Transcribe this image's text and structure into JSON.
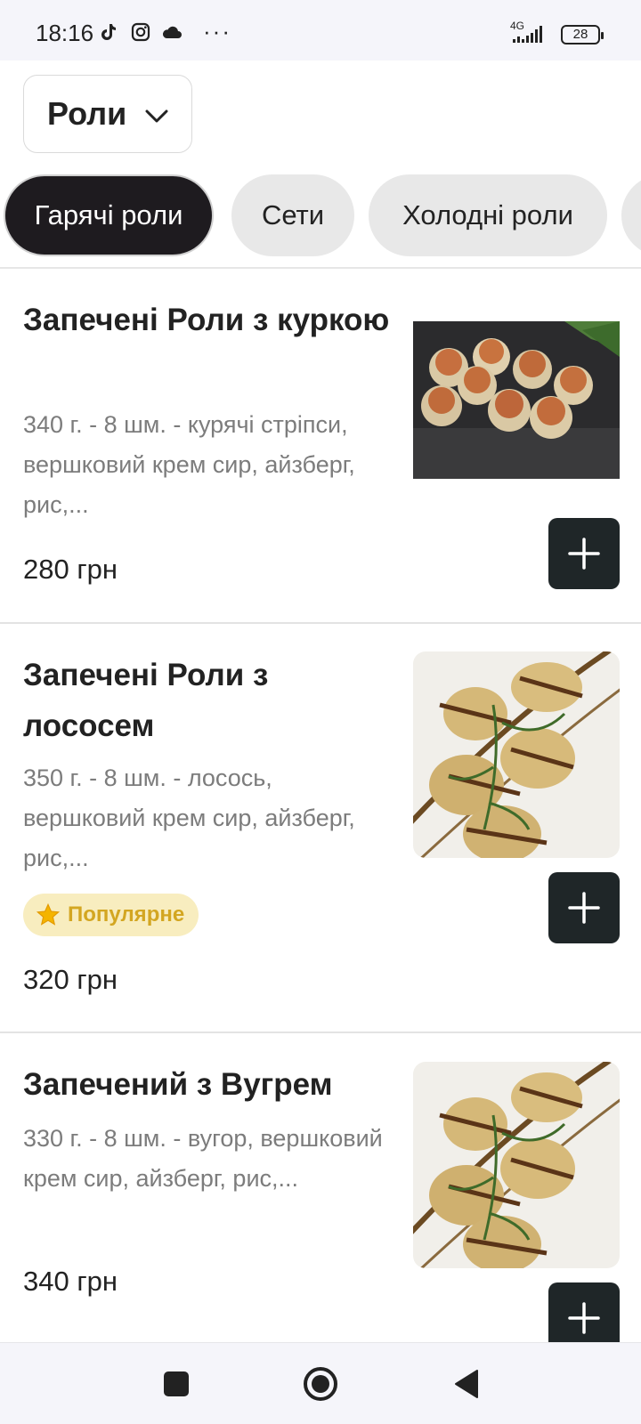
{
  "status_bar": {
    "time": "18:16",
    "network": "4G",
    "battery": "28",
    "icons": [
      "tiktok-icon",
      "instagram-icon",
      "cloud-icon",
      "more-dots-icon",
      "signal-icon",
      "battery-icon"
    ]
  },
  "category_selector": {
    "label": "Роли"
  },
  "tabs": [
    {
      "label": "Гарячі роли",
      "active": true
    },
    {
      "label": "Сети",
      "active": false
    },
    {
      "label": "Холодні роли",
      "active": false
    }
  ],
  "items": [
    {
      "title": "Запечені Роли з куркою",
      "description": "340 г. - 8 шм. - курячі стріпси, вершковий крем сир, айзберг, рис,...",
      "price": "280 грн"
    },
    {
      "title": "Запечені Роли з лососем",
      "description": "350 г. - 8 шм. - лосось, вершковий крем сир, айзберг, рис,...",
      "badge": "Популярне",
      "price": "320 грн"
    },
    {
      "title": "Запечений з Вугрем",
      "description": "330 г. - 8 шм. - вугор, вершковий крем сир, айзберг, рис,...",
      "price": "340 грн"
    }
  ],
  "colors": {
    "active_tab_bg": "#1e1b1f",
    "tab_bg": "#e8e8e8",
    "add_button_bg": "#1f2628",
    "badge_bg": "#f8edbf",
    "badge_text": "#d3a621",
    "description_text": "#7c7c7c"
  }
}
